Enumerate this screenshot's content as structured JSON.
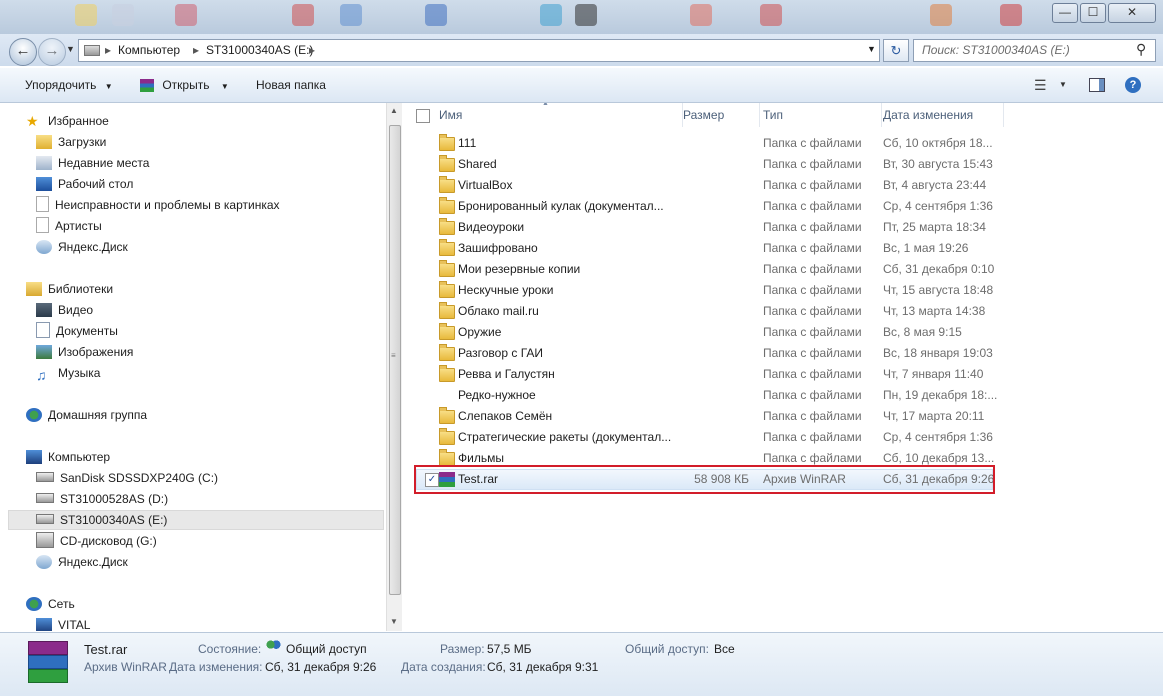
{
  "window": {
    "minimize": "—",
    "maximize": "☐",
    "close": "✕"
  },
  "address": {
    "segments": [
      "Компьютер",
      "ST31000340AS (E:)"
    ],
    "search_placeholder": "Поиск: ST31000340AS (E:)"
  },
  "toolbar": {
    "organize": "Упорядочить",
    "open": "Открыть",
    "new_folder": "Новая папка"
  },
  "nav": {
    "favorites": {
      "label": "Избранное",
      "items": [
        "Загрузки",
        "Недавние места",
        "Рабочий стол",
        "Неисправности и проблемы в картинках",
        "Артисты",
        "Яндекс.Диск"
      ]
    },
    "libraries": {
      "label": "Библиотеки",
      "items": [
        "Видео",
        "Документы",
        "Изображения",
        "Музыка"
      ]
    },
    "homegroup": "Домашняя группа",
    "computer": {
      "label": "Компьютер",
      "items": [
        "SanDisk SDSSDXP240G (C:)",
        "ST31000528AS (D:)",
        "ST31000340AS (E:)",
        "CD-дисковод (G:)",
        "Яндекс.Диск"
      ]
    },
    "network": {
      "label": "Сеть",
      "items": [
        "VITAL"
      ]
    }
  },
  "columns": {
    "name": "Имя",
    "size": "Размер",
    "type": "Тип",
    "date": "Дата изменения"
  },
  "files": [
    {
      "name": "111",
      "size": "",
      "type": "Папка с файлами",
      "date": "Сб, 10 октября 18..."
    },
    {
      "name": "Shared",
      "size": "",
      "type": "Папка с файлами",
      "date": "Вт, 30 августа 15:43"
    },
    {
      "name": "VirtualBox",
      "size": "",
      "type": "Папка с файлами",
      "date": "Вт, 4 августа 23:44"
    },
    {
      "name": "Бронированный кулак (документал...",
      "size": "",
      "type": "Папка с файлами",
      "date": "Ср, 4 сентября 1:36"
    },
    {
      "name": "Видеоуроки",
      "size": "",
      "type": "Папка с файлами",
      "date": "Пт, 25 марта 18:34"
    },
    {
      "name": "Зашифровано",
      "size": "",
      "type": "Папка с файлами",
      "date": "Вс, 1 мая 19:26"
    },
    {
      "name": "Мои резервные копии",
      "size": "",
      "type": "Папка с файлами",
      "date": "Сб, 31 декабря 0:10"
    },
    {
      "name": "Нескучные уроки",
      "size": "",
      "type": "Папка с файлами",
      "date": "Чт, 15 августа 18:48"
    },
    {
      "name": "Облако mail.ru",
      "size": "",
      "type": "Папка с файлами",
      "date": "Чт, 13 марта 14:38"
    },
    {
      "name": "Оружие",
      "size": "",
      "type": "Папка с файлами",
      "date": "Вс, 8 мая 9:15"
    },
    {
      "name": "Разговор с ГАИ",
      "size": "",
      "type": "Папка с файлами",
      "date": "Вс, 18 января 19:03"
    },
    {
      "name": "Ревва и Галустян",
      "size": "",
      "type": "Папка с файлами",
      "date": "Чт, 7 января 11:40"
    },
    {
      "name": "Редко-нужное",
      "size": "",
      "type": "Папка с файлами",
      "date": "Пн, 19 декабря 18:..."
    },
    {
      "name": "Слепаков Семён",
      "size": "",
      "type": "Папка с файлами",
      "date": "Чт, 17 марта 20:11"
    },
    {
      "name": "Стратегические ракеты (документал...",
      "size": "",
      "type": "Папка с файлами",
      "date": "Ср, 4 сентября 1:36"
    },
    {
      "name": "Фильмы",
      "size": "",
      "type": "Папка с файлами",
      "date": "Сб, 10 декабря 13..."
    },
    {
      "name": "Test.rar",
      "size": "58 908 КБ",
      "type": "Архив WinRAR",
      "date": "Сб, 31 декабря 9:26"
    }
  ],
  "details": {
    "name": "Test.rar",
    "type": "Архив WinRAR",
    "state_label": "Состояние:",
    "state_value": "Общий доступ",
    "modified_label": "Дата изменения:",
    "modified_value": "Сб, 31 декабря 9:26",
    "size_label": "Размер:",
    "size_value": "57,5 МБ",
    "created_label": "Дата создания:",
    "created_value": "Сб, 31 декабря 9:31",
    "share_label": "Общий доступ:",
    "share_value": "Все"
  }
}
